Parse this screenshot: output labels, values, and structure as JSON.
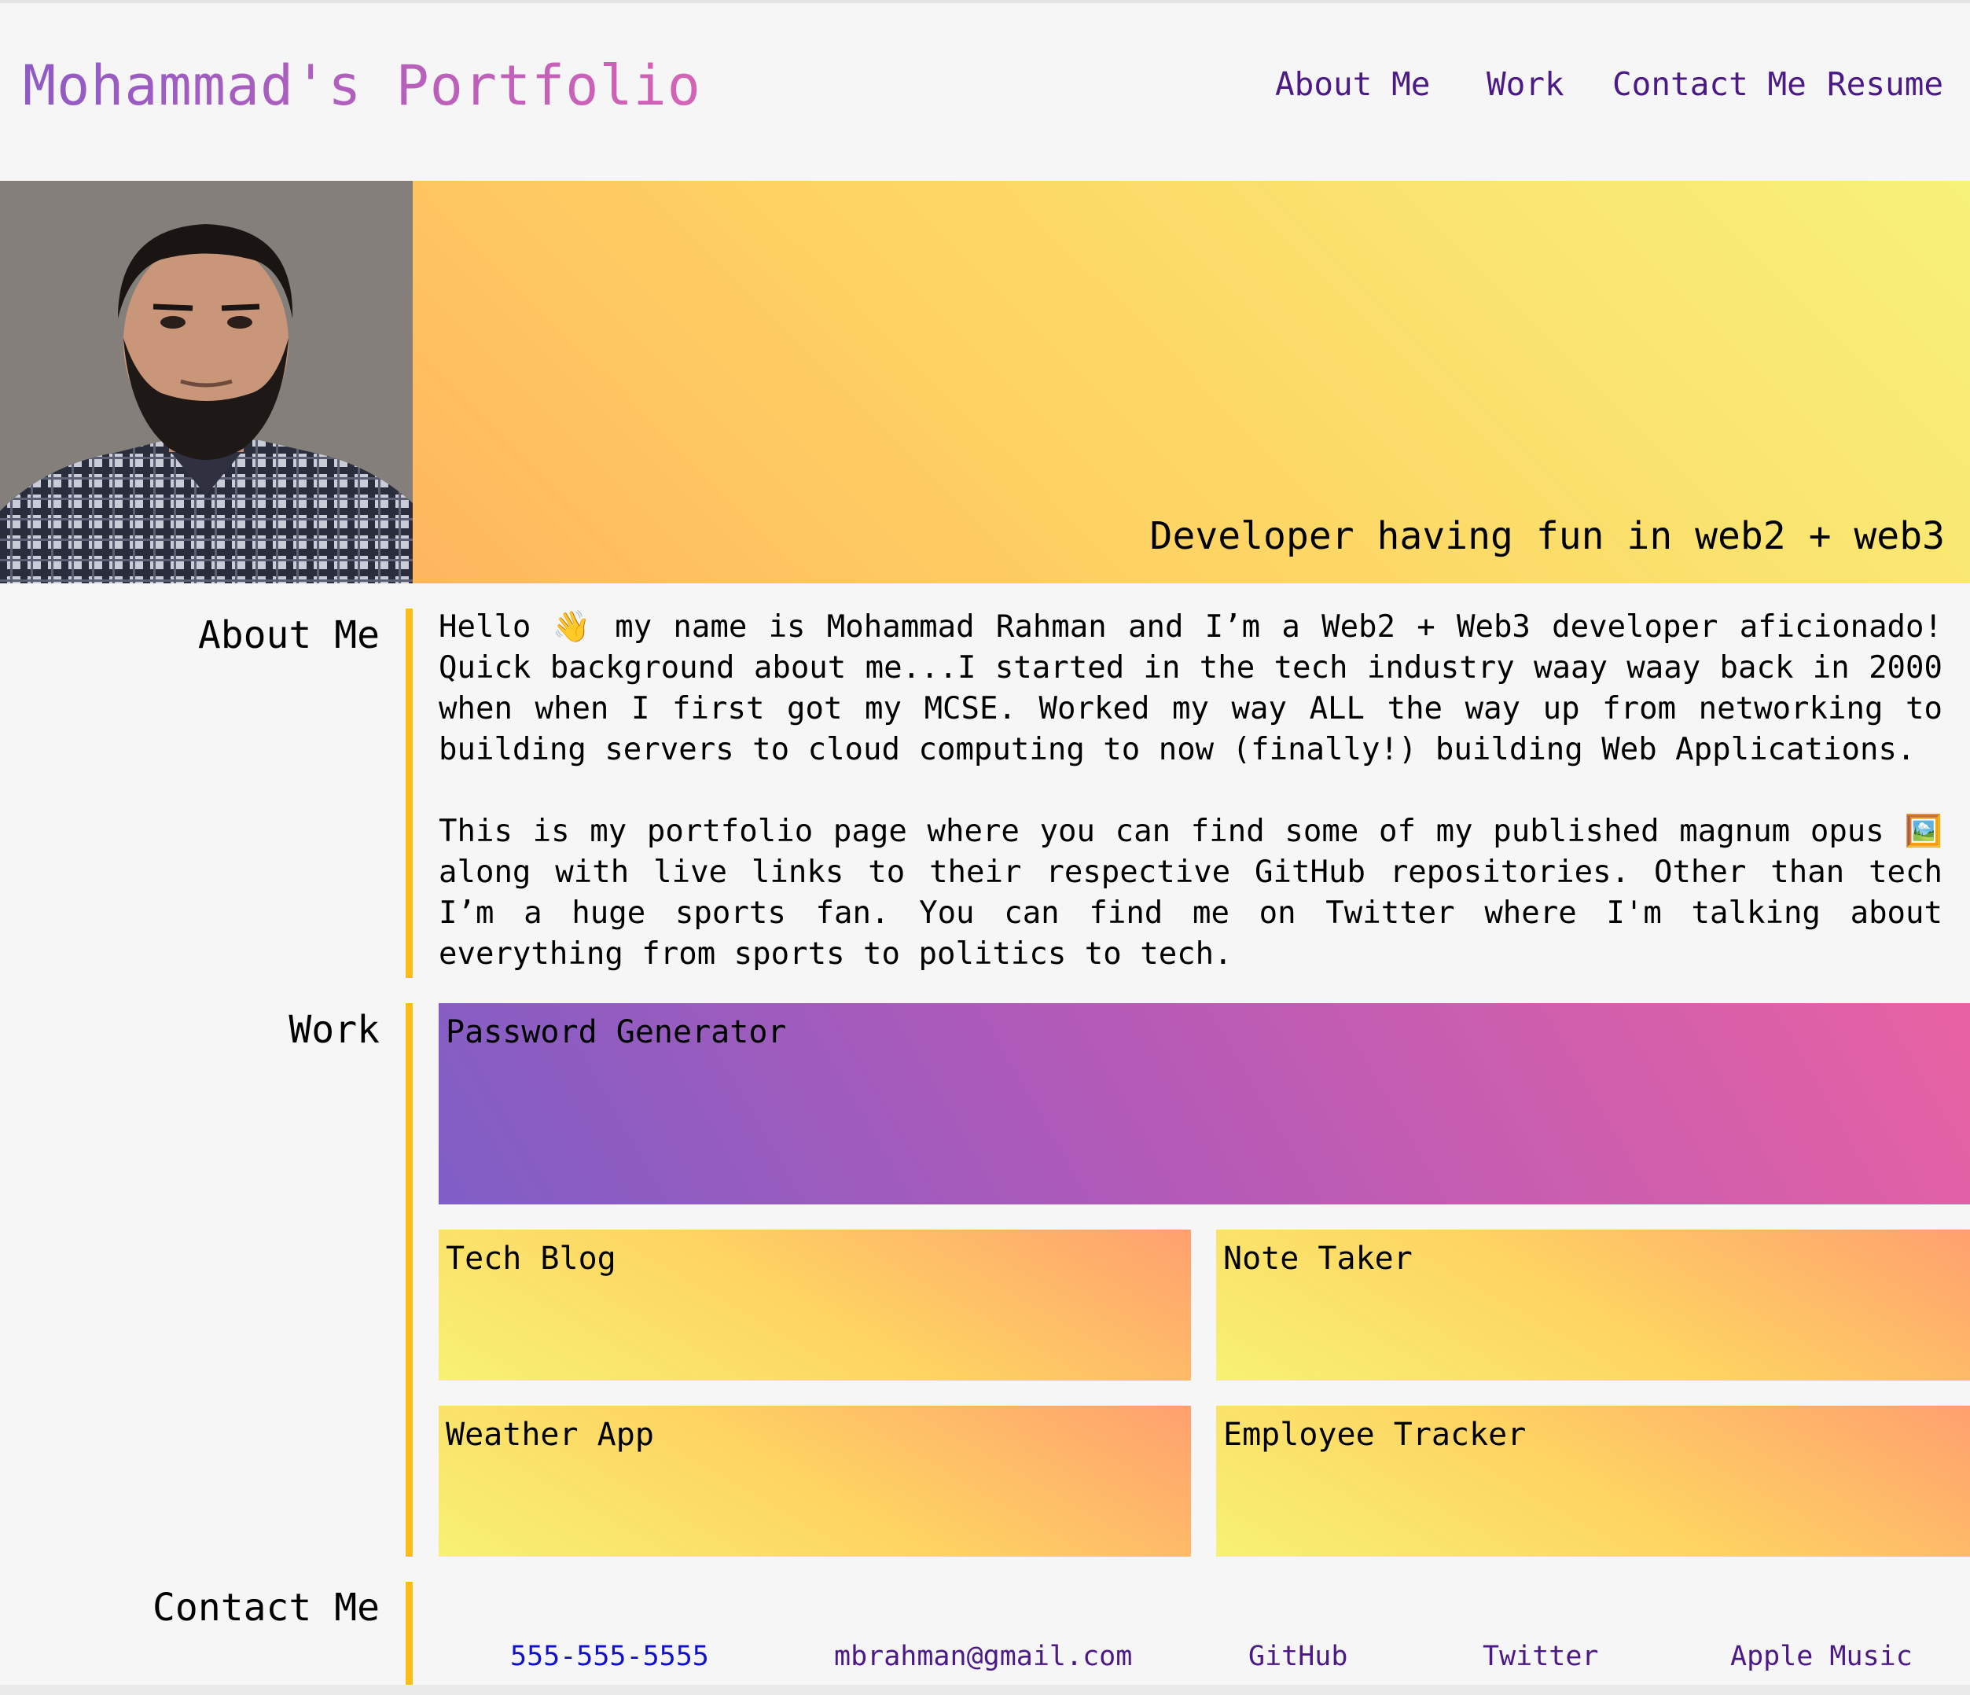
{
  "header": {
    "brand": "Mohammad's Portfolio",
    "nav": [
      "About Me",
      "Work",
      "Contact Me",
      "Resume"
    ]
  },
  "hero": {
    "photo_alt": "Portrait of Mohammad Rahman",
    "tagline": "Developer having fun in web2 + web3"
  },
  "about": {
    "title": "About Me",
    "paragraph1": "Hello 👋 my name is Mohammad Rahman and I’m a Web2 + Web3 developer aficionado! Quick background about me...I started in the tech industry waay waay back in 2000 when when I first got my MCSE. Worked my way ALL the way up from networking to building servers to cloud computing to now (finally!) building Web Applications.",
    "paragraph2": "This is my portfolio page where you can find some of my published magnum opus 🖼️ along with live links to their respective GitHub repositories. Other than tech I’m a huge sports fan. You can find me on Twitter where I'm talking about everything from sports to politics to tech."
  },
  "work": {
    "title": "Work",
    "projects": [
      "Password Generator",
      "Tech Blog",
      "Note Taker",
      "Weather App",
      "Employee Tracker"
    ]
  },
  "contact": {
    "title": "Contact Me",
    "links": [
      "555-555-5555",
      "mbrahman@gmail.com",
      "GitHub",
      "Twitter",
      "Apple Music"
    ]
  },
  "colors": {
    "accent_bar": "#fbbd16",
    "nav_link": "#4b1a86",
    "phone_link": "#1010d0"
  }
}
